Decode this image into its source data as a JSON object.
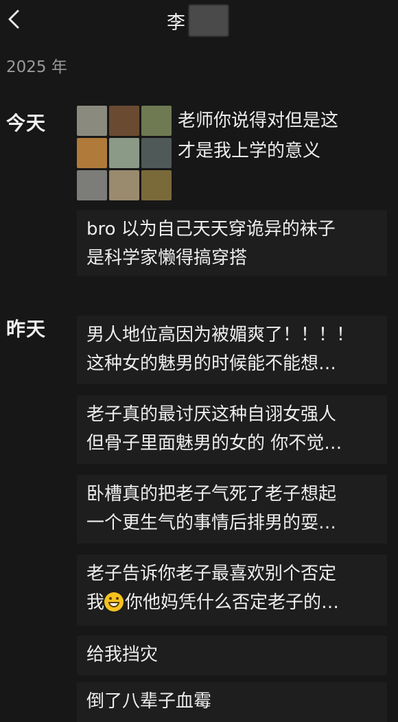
{
  "header": {
    "title": "李",
    "back_icon": "chevron-left-icon"
  },
  "year_label": "2025 年",
  "sections": [
    {
      "day": "今天",
      "image_post": {
        "caption": [
          "老师你说得对但是这",
          "才是我上学的意义"
        ],
        "thumbnail_colors": [
          "#8a8a7e",
          "#6b4a32",
          "#6f7a52",
          "#b07a3a",
          "#8a9a86",
          "#4f5a58",
          "#7c7c78",
          "#9a8a6e",
          "#7a6a3a"
        ]
      },
      "posts": [
        {
          "lines": [
            "bro 以为自己天天穿诡异的袜子",
            "是科学家懒得搞穿搭"
          ]
        }
      ]
    },
    {
      "day": "昨天",
      "posts": [
        {
          "lines": [
            "男人地位高因为被媚爽了！！！！",
            "这种女的魅男的时候能不能想…"
          ]
        },
        {
          "lines": [
            "老子真的最讨厌这种自诩女强人",
            "但骨子里面魅男的女的 你不觉…"
          ]
        },
        {
          "lines": [
            "卧槽真的把老子气死了老子想起",
            "一个更生气的事情后排男的耍…"
          ]
        },
        {
          "lines": [
            "老子告诉你老子最喜欢别个否定",
            "我",
            "你他妈凭什么否定老子的…"
          ],
          "emoji": "grinning-face-icon"
        },
        {
          "lines": [
            "给我挡灾"
          ]
        },
        {
          "lines": [
            "倒了八辈子血霉"
          ]
        }
      ]
    }
  ]
}
